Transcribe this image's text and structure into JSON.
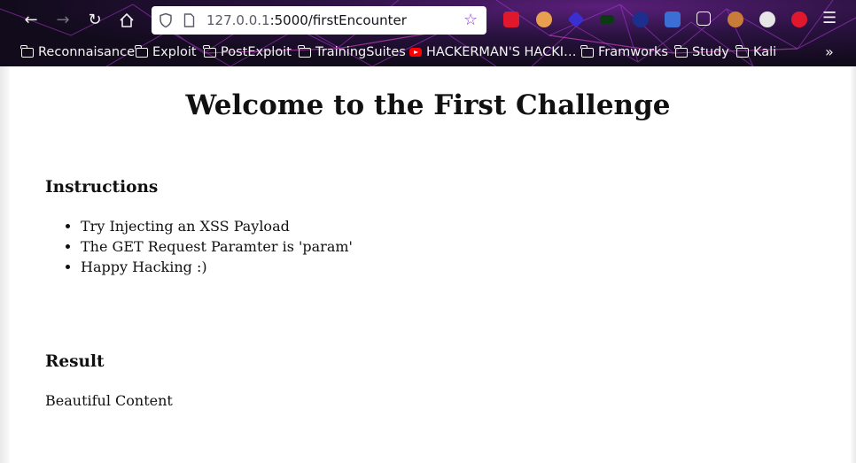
{
  "browser": {
    "url_host": "127.0.0.1",
    "url_rest": ":5000/firstEncounter",
    "bookmarks": [
      {
        "label": "Reconnaisance",
        "icon": "folder-icon"
      },
      {
        "label": "Exploit",
        "icon": "folder-icon"
      },
      {
        "label": "PostExploit",
        "icon": "folder-icon"
      },
      {
        "label": "TrainingSuites",
        "icon": "folder-icon"
      },
      {
        "label": "HACKERMAN'S HACKI…",
        "icon": "youtube-icon"
      },
      {
        "label": "Framworks",
        "icon": "folder-icon"
      },
      {
        "label": "Study",
        "icon": "folder-icon"
      },
      {
        "label": "Kali",
        "icon": "folder-icon"
      }
    ],
    "toolbar_icons": [
      "back-icon",
      "forward-icon",
      "reload-icon",
      "home-icon",
      "shield-icon",
      "page-icon",
      "bookmark-star-icon",
      "menu-icon",
      "chevron-more-icon"
    ],
    "theme_accent": "#8a3fd0"
  },
  "page": {
    "title": "Welcome to the First Challenge",
    "instructions_heading": "Instructions",
    "instructions": [
      "Try Injecting an XSS Payload",
      "The GET Request Paramter is 'param'",
      "Happy Hacking :)"
    ],
    "result_heading": "Result",
    "result_text": "Beautiful Content"
  }
}
